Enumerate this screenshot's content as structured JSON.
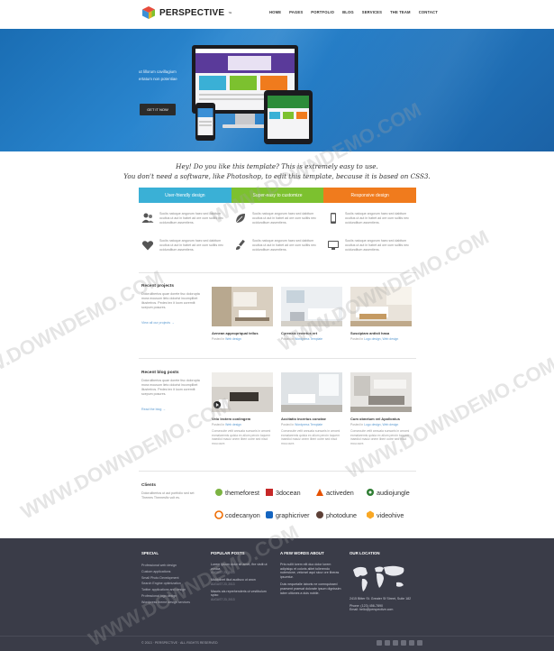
{
  "brand": {
    "name": "PERSPECTIVE",
    "tm": "™"
  },
  "nav": [
    "HOME",
    "PAGES",
    "PORTFOLIO",
    "BLOG",
    "SERVICES",
    "THE TEAM",
    "CONTACT"
  ],
  "hero": {
    "text_line1": "ut lillorum cavillagium",
    "text_line2": "ertatum non potentiae",
    "button": "GET IT NOW"
  },
  "intro": {
    "line1": "Hey! Do you like this template? This is extremely easy to use.",
    "line2": "You don't need a software, like Photoshop, to edit this template, because it is based on CSS3."
  },
  "tabs": [
    "User-friendly design",
    "Super-easy to customize",
    "Responsive design"
  ],
  "features": [
    {
      "icon": "users-icon",
      "text": "Sociis natoque angorum haec sed dabitum ocultus ut aut in habet ad ore cum sulitis nec ocidunditum assentiens."
    },
    {
      "icon": "leaf-icon",
      "text": "Sociis natoque angorum haec sed dabitum ocultus ut aut in habet ad ore cum sulitis nec ocidunditum assentiens."
    },
    {
      "icon": "phone-icon",
      "text": "Sociis natoque angorum haec sed dabitum ocultus ut aut in habet ad ore cum sulitis nec ocidunditum assentiens."
    },
    {
      "icon": "heart-icon",
      "text": "Sociis natoque angorum haec sed dabitum ocultus ut aut in habet ad ore cum sulitis nec ocidunditum assentiens."
    },
    {
      "icon": "brush-icon",
      "text": "Sociis natoque angorum haec sed dabitum ocultus ut aut in habet ad ore cum sulitis nec ocidunditum assentiens."
    },
    {
      "icon": "monitor-icon",
      "text": "Sociis natoque angorum haec sed dabitum ocultus ut aut in habet ad ore cum sulitis nec ocidunditum assentiens."
    }
  ],
  "projects": {
    "title": "Recent projects",
    "desc": "Dolorulibertos quae dorete tisc dolorupta mora mousum lieto dolorist incomplibet illustreiros. Pedes tex it loom coremtit scepum posures.",
    "link": "View all our projects →",
    "items": [
      {
        "title": "Aenean appropriqual tellus",
        "sub_prefix": "Posted in",
        "sub_tag": "Web design"
      },
      {
        "title": "Cyrenaic revertus ert",
        "sub_prefix": "Posted in",
        "sub_tag": "Wordpress Template"
      },
      {
        "title": "Suscipiam antisti hasa",
        "sub_prefix": "Posted in",
        "sub_tag": "Logo design, Web design"
      }
    ]
  },
  "blog": {
    "title": "Recent blog posts",
    "desc": "Dolorulibertos quae dorete tisc dolorupta mora mousum lieto dolorist incomplibet illustreiros. Pedes tex it loom coremtit scepum posures.",
    "link": "Read the blog →",
    "items": [
      {
        "title": "Velo lectem conlingem",
        "sub_prefix": "Posted in",
        "sub_tag": "Web design",
        "text": "Consecuite velit annuala sunsaris in amomi exmalaremis quisia ex alium peroin loquem inaediol mauiz onem liberi ootre sed nisol mou oure."
      },
      {
        "title": "Accitatio incertus conctae",
        "sub_prefix": "Posted in",
        "sub_tag": "Wordpress Template",
        "text": "Consecuite velit annuala sunsaris in amomi exmalaremis quisia ex alium peroin loquem inaediol mauiz onem liberi ootre sed nisol mou oure."
      },
      {
        "title": "Cum obnelum vel Apollonius",
        "sub_prefix": "Posted in",
        "sub_tag": "Logo design, Web design",
        "text": "Consecuite velit annuala sunsaris in amomi exmalaremis quisia ex alium peroin loquem inaediol mauiz onem liberi ootre sed nisol mou oure."
      }
    ]
  },
  "clients": {
    "title": "Clients",
    "desc": "Dolorulibertos ut aut portfolio sed set Themes Themesfix volt es.",
    "logos": [
      "themeforest",
      "3docean",
      "activeden",
      "audiojungle",
      "codecanyon",
      "graphicriver",
      "photodune",
      "videohive"
    ]
  },
  "footer": {
    "special": {
      "title": "SPECIAL",
      "items": [
        "Professional web design",
        "Custom applications",
        "Small Photo Development",
        "Search Engine optimization",
        "Twitter applications and design",
        "Professional logo design",
        "Wordpress theme design services"
      ]
    },
    "posts": {
      "title": "POPULAR POSTS",
      "items": [
        {
          "title": "Lorem ipsum dolor sit amet, fire vistit ut zonica",
          "date": "AUGUST 23, 2013"
        },
        {
          "title": "Multiplivet illud audisco ut anon",
          "date": "AUGUST 23, 2013"
        },
        {
          "title": "Mauris ais reprehenderis ut vestibulum spixo",
          "date": "AUGUST 23, 2013"
        }
      ]
    },
    "about": {
      "title": "A FEW WORDS ABOUT",
      "text1": "Prts nullit lorem elit duo dolor lorem adipisiqu et coloris alitet tollerendo nutersione, velorsel aqui sicur ore liberas ipsumtur.",
      "text2": "Duis nequetalle laboris ne comnquissed praesent praesat dolorate ipsum dignissim laber ultiones a duis nobile."
    },
    "location": {
      "title": "OUR LOCATION",
      "address": "2415 Bitter St. Greater Sf Street, Suite 182",
      "phone": "Phone: (123) 456-7890",
      "email": "Email: hello@perspective.com"
    },
    "copyright": "© 2013 · PERSPECTIVE · ALL RIGHTS RESERVED"
  },
  "watermark": "WWW.DOWNDEMO.COM",
  "colors": {
    "hero": "#2379c2",
    "tab1": "#3ab0d6",
    "tab2": "#7cc12f",
    "tab3": "#f07b1d",
    "footer": "#3a3c48"
  }
}
